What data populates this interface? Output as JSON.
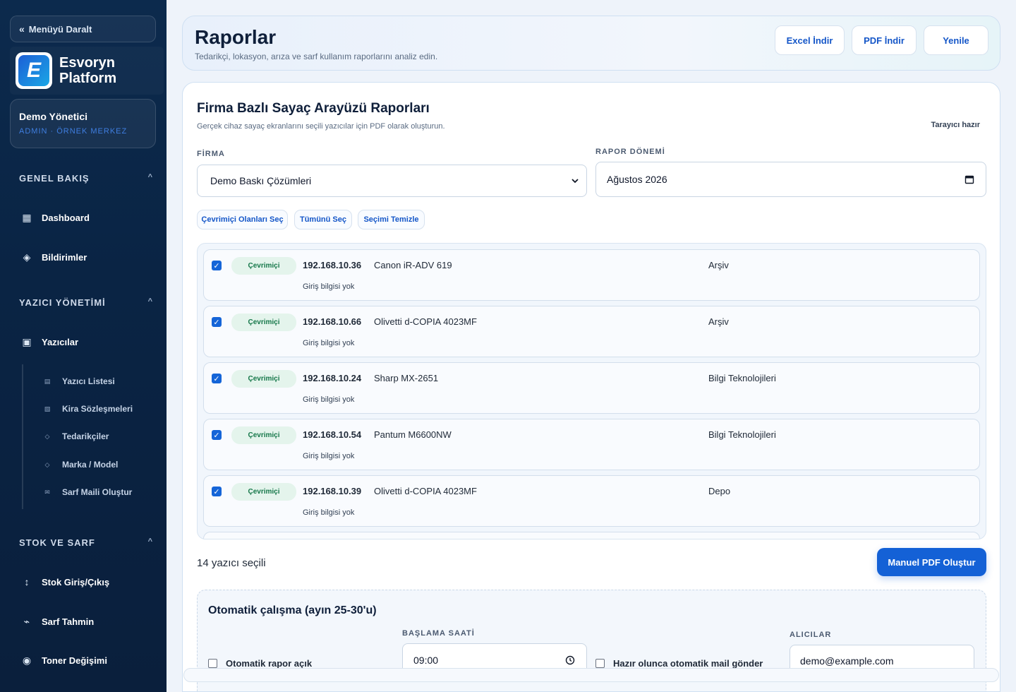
{
  "sidebar": {
    "collapse_label": "Menüyü Daralt",
    "brand_line1": "Esvoryn",
    "brand_line2": "Platform",
    "user_name": "Demo Yönetici",
    "user_role": "ADMIN · ÖRNEK MERKEZ",
    "sections": [
      {
        "title": "GENEL BAKIŞ",
        "caret": "^"
      },
      {
        "title": "YAZICI YÖNETİMİ",
        "caret": "^"
      },
      {
        "title": "STOK VE SARF",
        "caret": "^"
      }
    ],
    "items": [
      {
        "label": "Dashboard",
        "icon": "▦"
      },
      {
        "label": "Bildirimler",
        "icon": "◈"
      },
      {
        "label": "Yazıcılar",
        "icon": "▣"
      },
      {
        "label": "Stok Giriş/Çıkış",
        "icon": "↕"
      },
      {
        "label": "Sarf Tahmin",
        "icon": "⌁"
      },
      {
        "label": "Toner Değişimi",
        "icon": "◉"
      }
    ],
    "subitems": [
      {
        "label": "Yazıcı Listesi",
        "icon": "▤"
      },
      {
        "label": "Kira Sözleşmeleri",
        "icon": "▧"
      },
      {
        "label": "Tedarikçiler",
        "icon": "◇"
      },
      {
        "label": "Marka / Model",
        "icon": "◇"
      },
      {
        "label": "Sarf Maili Oluştur",
        "icon": "✉"
      }
    ]
  },
  "header": {
    "title": "Raporlar",
    "subtitle": "Tedarikçi, lokasyon, arıza ve sarf kullanım raporlarını analiz edin.",
    "excel_label": "Excel İndir",
    "pdf_label": "PDF İndir",
    "refresh_label": "Yenile"
  },
  "report": {
    "title": "Firma Bazlı Sayaç Arayüzü Raporları",
    "subtitle": "Gerçek cihaz sayaç ekranlarını seçili yazıcılar için PDF olarak oluşturun.",
    "status": "Tarayıcı hazır",
    "firma_label": "FİRMA",
    "firma_value": "Demo Baskı Çözümleri",
    "period_label": "RAPOR DÖNEMİ",
    "period_value": "Ağustos 2026",
    "chips": [
      "Çevrimiçi Olanları Seç",
      "Tümünü Seç",
      "Seçimi Temizle"
    ],
    "printers": [
      {
        "status": "Çevrimiçi",
        "ip": "192.168.10.36",
        "model": "Canon iR-ADV 619",
        "location": "Arşiv",
        "login": "Giriş bilgisi yok"
      },
      {
        "status": "Çevrimiçi",
        "ip": "192.168.10.66",
        "model": "Olivetti d-COPIA 4023MF",
        "location": "Arşiv",
        "login": "Giriş bilgisi yok"
      },
      {
        "status": "Çevrimiçi",
        "ip": "192.168.10.24",
        "model": "Sharp MX-2651",
        "location": "Bilgi Teknolojileri",
        "login": "Giriş bilgisi yok"
      },
      {
        "status": "Çevrimiçi",
        "ip": "192.168.10.54",
        "model": "Pantum M6600NW",
        "location": "Bilgi Teknolojileri",
        "login": "Giriş bilgisi yok"
      },
      {
        "status": "Çevrimiçi",
        "ip": "192.168.10.39",
        "model": "Olivetti d-COPIA 4023MF",
        "location": "Depo",
        "login": "Giriş bilgisi yok"
      }
    ],
    "selected_count": "14 yazıcı seçili",
    "manual_pdf_label": "Manuel PDF Oluştur"
  },
  "auto": {
    "title": "Otomatik çalışma (ayın 25-30'u)",
    "enabled_label": "Otomatik rapor açık",
    "start_label": "BAŞLAMA SAATİ",
    "start_value": "09:00",
    "mail_label": "Hazır olunca otomatik mail gönder",
    "recipients_label": "ALICILAR",
    "recipients_value": "demo@example.com"
  },
  "colors": {
    "primary": "#1461d6",
    "online_bg": "#e4f4ec",
    "online_text": "#16784a",
    "sidebar_bg": "#0a2444"
  }
}
